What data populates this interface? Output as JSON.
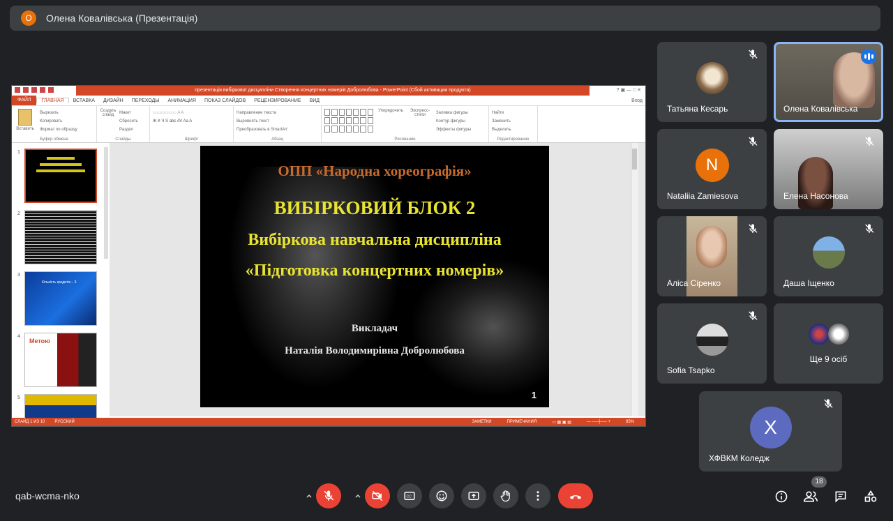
{
  "presenter": {
    "initial": "О",
    "label": "Олена Ковалівська (Презентація)"
  },
  "ppt": {
    "window_title": "презентація вибіркової дисципліни Створення концертних номерів Добролюбова - PowerPoint (Сбой активации продукта)",
    "login": "Вход",
    "tabs": [
      "ФАЙЛ",
      "ГЛАВНАЯ",
      "ВСТАВКА",
      "ДИЗАЙН",
      "ПЕРЕХОДЫ",
      "АНИМАЦИЯ",
      "ПОКАЗ СЛАЙДОВ",
      "РЕЦЕНЗИРОВАНИЕ",
      "ВИД"
    ],
    "ribbon": {
      "paste": "Вставить",
      "cut": "Вырезать",
      "copy": "Копировать",
      "format": "Формат по образцу",
      "clipboard_group": "Буфер обмена",
      "new_slide": "Создать слайд",
      "layout": "Макет",
      "reset": "Сбросить",
      "section": "Раздел",
      "slides_group": "Слайды",
      "font_group": "Шрифт",
      "text_dir": "Направление текста",
      "align_text": "Выровнять текст",
      "smartart": "Преобразовать в SmartArt",
      "paragraph_group": "Абзац",
      "arrange": "Упорядочить",
      "quick_styles": "Экспресс-стили",
      "fill": "Заливка фигуры",
      "outline": "Контур фигуры",
      "effects": "Эффекты фигуры",
      "drawing_group": "Рисование",
      "find": "Найти",
      "replace": "Заменить",
      "select": "Выделить",
      "editing_group": "Редактирование"
    },
    "slide_numbers": [
      "1",
      "2",
      "3",
      "4",
      "5"
    ],
    "thumb3_text": "Кількість кредитів – 3",
    "thumb4_text": "Метою",
    "slide": {
      "line1": "ОПП «Народна хореографія»",
      "line2": "ВИБІРКОВИЙ БЛОК 2",
      "line3": "Вибіркова навчальна дисципліна",
      "line4": "«Підготовка концертних номерів»",
      "line5": "Викладач",
      "line6": "Наталія  Володимирівна  Добролюбова",
      "page": "1"
    },
    "status": {
      "slide_of": "СЛАЙД 1 ИЗ 10",
      "lang": "РУССКИЙ",
      "notes": "ЗАМЕТКИ",
      "comments": "ПРИМЕЧАНИЯ",
      "zoom": "85%"
    }
  },
  "participants": [
    {
      "name": "Татьяна Кесарь"
    },
    {
      "name": "Олена Ковалівська"
    },
    {
      "name": "Nataliia Zamiesova",
      "initial": "N"
    },
    {
      "name": "Елена Насонова"
    },
    {
      "name": "Аліса Сіренко"
    },
    {
      "name": "Даша Іщенко"
    },
    {
      "name": "Sofia Tsapko"
    },
    {
      "name": "Ще 9 осіб"
    },
    {
      "name": "ХФВКМ Коледж",
      "initial": "Х"
    }
  ],
  "meeting": {
    "code": "qab-wcma-nko",
    "people_count": "18"
  },
  "colors": {
    "accent": "#8ab4f8",
    "end_call": "#ea4335",
    "n_avatar": "#e8710a",
    "x_avatar": "#5c6bc0"
  },
  "icons": [
    "mic-off-icon",
    "camera-off-icon",
    "captions-icon",
    "emoji-icon",
    "present-icon",
    "raise-hand-icon",
    "more-icon",
    "end-call-icon",
    "info-icon",
    "people-icon",
    "chat-icon",
    "activities-icon"
  ]
}
